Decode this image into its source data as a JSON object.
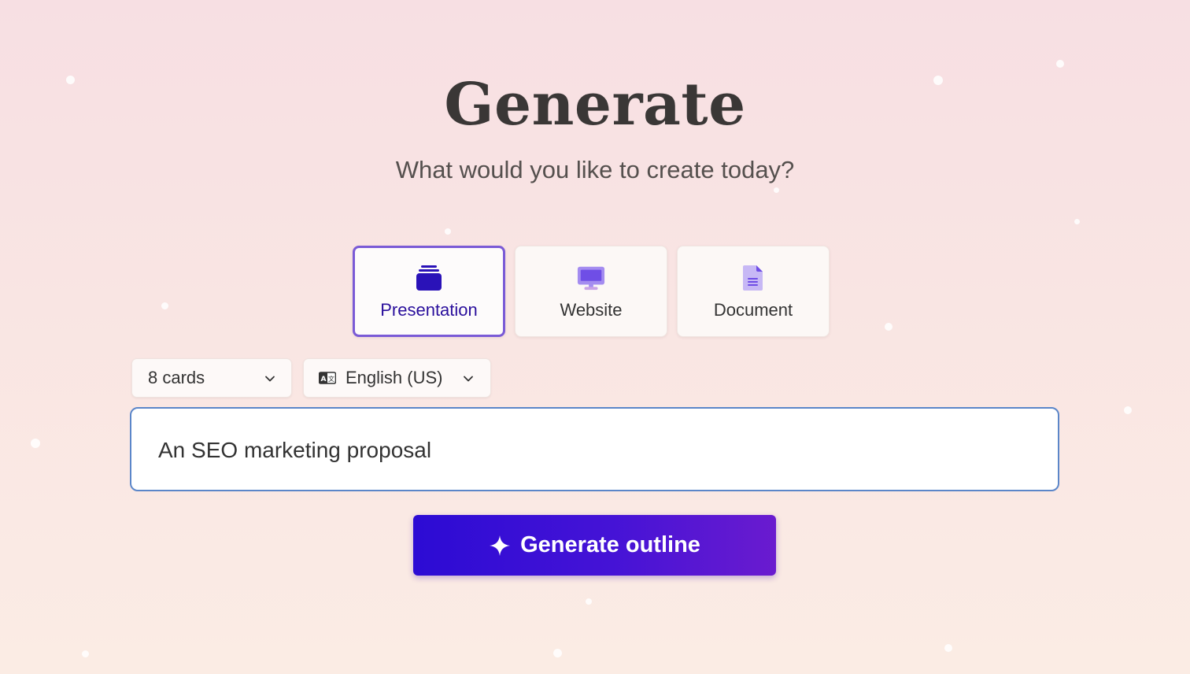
{
  "header": {
    "title": "Generate",
    "subtitle": "What would you like to create today?"
  },
  "content_types": [
    {
      "label": "Presentation",
      "icon": "presentation-stack-icon",
      "selected": true
    },
    {
      "label": "Website",
      "icon": "monitor-icon",
      "selected": false
    },
    {
      "label": "Document",
      "icon": "document-icon",
      "selected": false
    }
  ],
  "options": {
    "cards_select": {
      "value": "8 cards",
      "icon": "chevron-down-icon"
    },
    "language_select": {
      "value": "English (US)",
      "icon": "language-icon"
    }
  },
  "prompt": {
    "value": "An SEO marketing proposal"
  },
  "generate_button": {
    "label": "Generate outline",
    "icon": "sparkle-icon"
  },
  "colors": {
    "accent": "#4513d6",
    "selected_border": "#7a5ad6",
    "input_border": "#5b86c9",
    "selected_text": "#2a0f9c"
  }
}
